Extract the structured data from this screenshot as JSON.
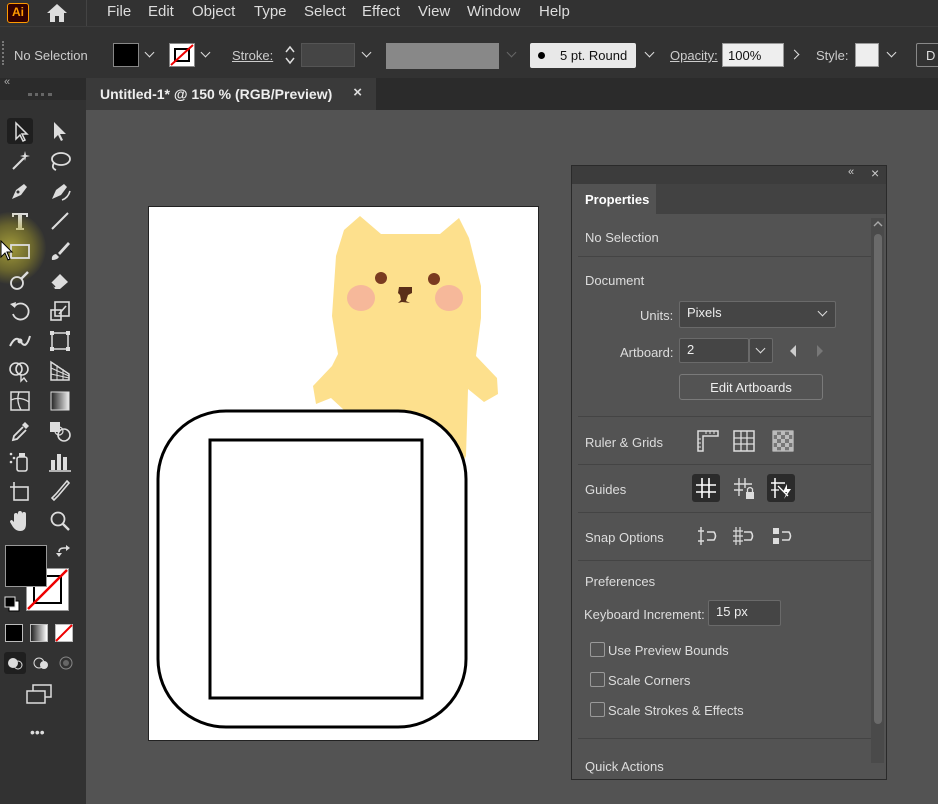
{
  "app": {
    "logo": "Ai"
  },
  "menu": [
    "File",
    "Edit",
    "Object",
    "Type",
    "Select",
    "Effect",
    "View",
    "Window",
    "Help"
  ],
  "control_bar": {
    "selection": "No Selection",
    "stroke_label": "Stroke:",
    "brush": "5 pt. Round",
    "opacity_label": "Opacity:",
    "opacity_value": "100%",
    "style_label": "Style:",
    "overflow": "D"
  },
  "document_tab": {
    "title": "Untitled-1* @ 150 % (RGB/Preview)",
    "close": "×"
  },
  "properties": {
    "tab": "Properties",
    "selection_state": "No Selection",
    "document_heading": "Document",
    "units_label": "Units:",
    "units_value": "Pixels",
    "artboard_label": "Artboard:",
    "artboard_value": "2",
    "edit_artboards": "Edit Artboards",
    "ruler_grids": "Ruler & Grids",
    "guides": "Guides",
    "snap_options": "Snap Options",
    "preferences": "Preferences",
    "keyboard_increment_label": "Keyboard Increment:",
    "keyboard_increment_value": "15 px",
    "use_preview_bounds": "Use Preview Bounds",
    "scale_corners": "Scale Corners",
    "scale_strokes": "Scale Strokes & Effects",
    "quick_actions": "Quick Actions"
  },
  "toolbar": {
    "more": "•••"
  },
  "colors": {
    "accent": "#ff9a00",
    "bear": "#fde08d",
    "cheek": "#f6b89a",
    "ui_dark": "#323232",
    "panel": "#535353"
  }
}
